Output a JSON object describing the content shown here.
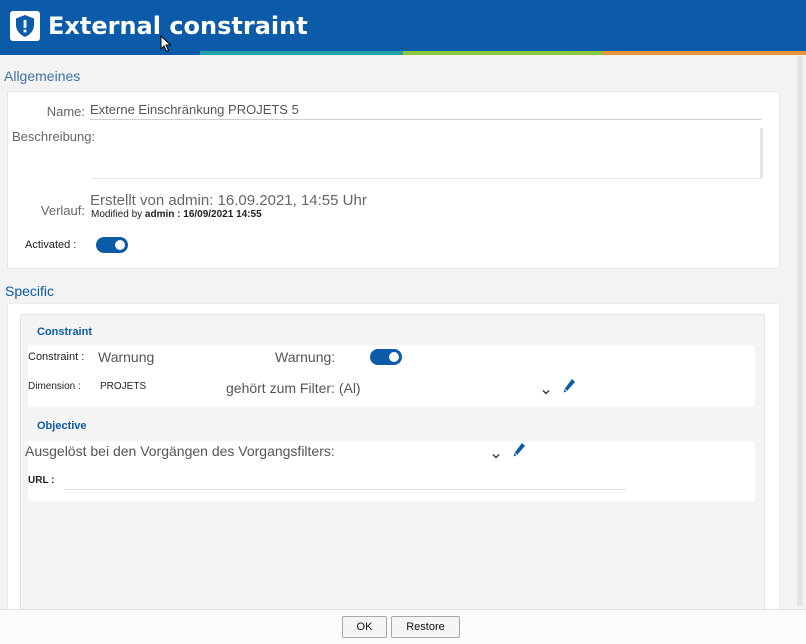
{
  "window": {
    "title": "External constraint"
  },
  "general": {
    "section_title": "Allgemeines",
    "name_label": "Name:",
    "name_value": "Externe Einschränkung PROJETS 5",
    "description_label": "Beschreibung:",
    "description_value": "",
    "history_label": "Verlauf:",
    "history_created": "Erstellt von admin: 16.09.2021, 14:55 Uhr",
    "history_modified_prefix": "Modified by",
    "history_modified_user": "admin : 16/09/2021 14:55",
    "activated_label": "Activated :",
    "activated": true
  },
  "specific": {
    "section_title": "Specific",
    "constraint_header": "Constraint",
    "constraint_label": "Constraint :",
    "constraint_value": "Warnung",
    "warning_label": "Warnung:",
    "warning_enabled": true,
    "dimension_label": "Dimension :",
    "dimension_value": "PROJETS",
    "filter_value": "gehört zum Filter: (Al)",
    "objective_header": "Objective",
    "trigger_value": "Ausgelöst bei den Vorgängen des Vorgangsfilters:",
    "url_label": "URL :",
    "url_value": ""
  },
  "footer": {
    "ok_label": "OK",
    "restore_label": "Restore"
  },
  "colors": {
    "titlebar": "#0b5ba8",
    "stripe_teal": "#1fa3a6",
    "stripe_green": "#8cc63f",
    "stripe_orange": "#e8953a",
    "accent": "#0b5ba8"
  },
  "icons": [
    "shield-exclamation-icon",
    "mouse-cursor-icon",
    "chevron-down-icon",
    "pencil-icon"
  ]
}
